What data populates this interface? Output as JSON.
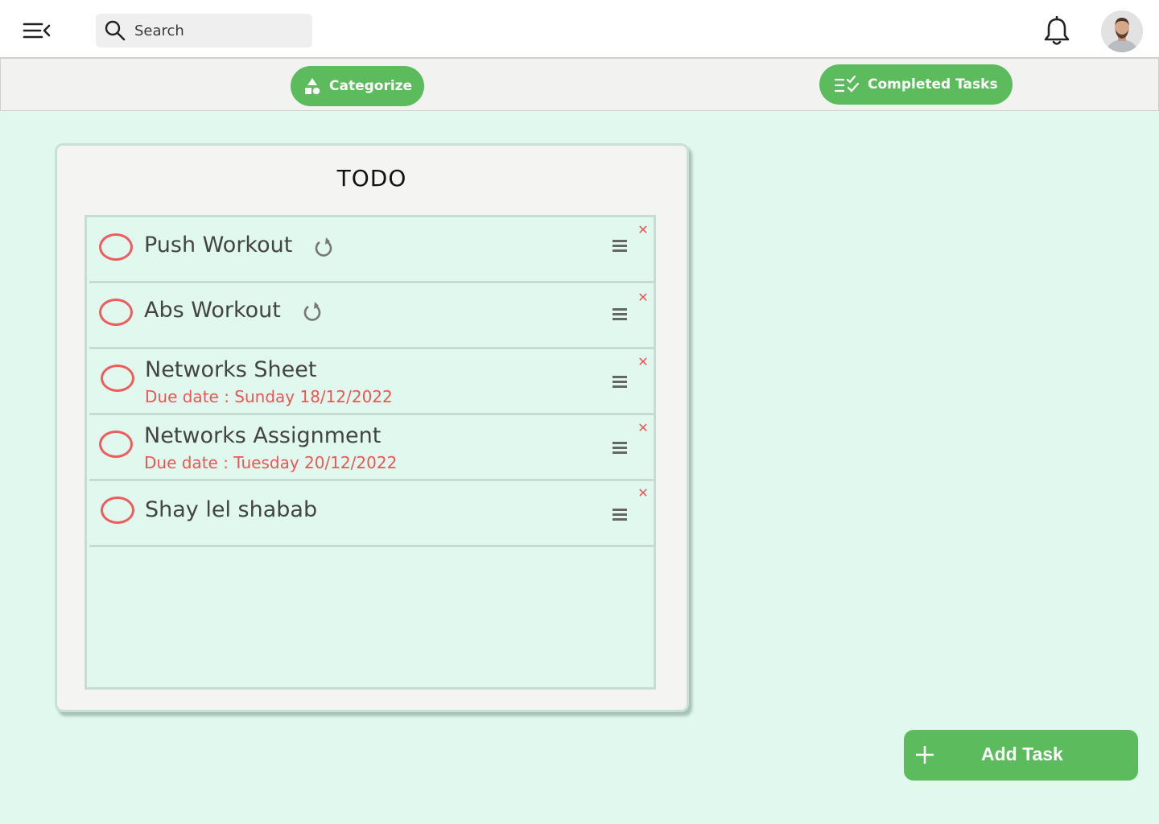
{
  "header": {
    "search_placeholder": "Search"
  },
  "toolbar": {
    "categorize_label": "Categorize",
    "completed_label": "Completed Tasks"
  },
  "todo": {
    "title": "TODO",
    "tasks": [
      {
        "name": "Push Workout",
        "due": "",
        "repeating": true
      },
      {
        "name": "Abs Workout",
        "due": "",
        "repeating": true
      },
      {
        "name": "Networks Sheet",
        "due": "Due date : Sunday 18/12/2022",
        "repeating": false
      },
      {
        "name": "Networks Assignment",
        "due": "Due date : Tuesday 20/12/2022",
        "repeating": false
      },
      {
        "name": "Shay lel shabab",
        "due": "",
        "repeating": false
      }
    ]
  },
  "add_task_label": "Add Task",
  "colors": {
    "accent_green": "#5cbb5c",
    "page_background": "#e0f8ee",
    "due_red": "#ee5555",
    "check_red": "#ee5d5d"
  },
  "icons": {
    "menu": "menu-collapse-icon",
    "search": "search-icon",
    "notifications": "bell-icon",
    "categorize": "shapes-icon",
    "completed": "checklist-icon",
    "repeat": "repeat-icon",
    "drag": "drag-handle-icon",
    "delete": "close-icon",
    "add": "plus-icon"
  }
}
